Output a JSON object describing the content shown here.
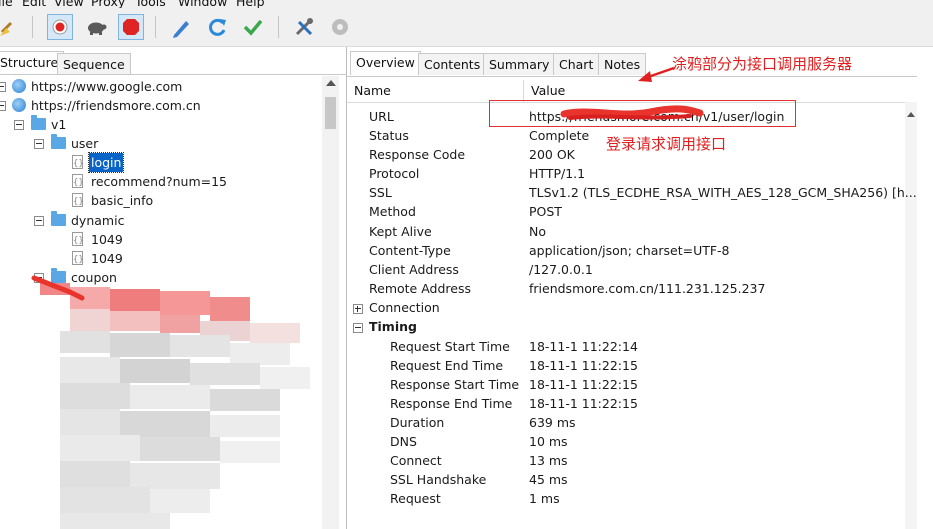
{
  "menu": [
    "ile",
    "Edit",
    "View",
    "Proxy",
    "Tools",
    "Window",
    "Help"
  ],
  "toolbar": {
    "icons": [
      "broom-icon",
      "turtle-icon",
      "record-icon",
      "stop-icon",
      "pen-icon",
      "refresh-icon",
      "check-icon",
      "tools-icon",
      "settings-icon"
    ]
  },
  "left_tabs": [
    "Structure",
    "Sequence"
  ],
  "tree": {
    "hosts": [
      "https://www.google.com",
      "https://friendsmore.com.cn"
    ],
    "v1": "v1",
    "user": "user",
    "user_items": [
      "login",
      "recommend?num=15",
      "basic_info"
    ],
    "dynamic": "dynamic",
    "dynamic_items": [
      "1049",
      "1049"
    ],
    "coupon": "coupon"
  },
  "right_tabs": [
    "Overview",
    "Contents",
    "Summary",
    "Chart",
    "Notes"
  ],
  "grid_headers": {
    "name": "Name",
    "value": "Value"
  },
  "overview": [
    {
      "name": "URL",
      "value": "https://friendsmore.com.cn/v1/user/login"
    },
    {
      "name": "Status",
      "value": "Complete"
    },
    {
      "name": "Response Code",
      "value": "200 OK"
    },
    {
      "name": "Protocol",
      "value": "HTTP/1.1"
    },
    {
      "name": "SSL",
      "value": "TLSv1.2 (TLS_ECDHE_RSA_WITH_AES_128_GCM_SHA256) [h..."
    },
    {
      "name": "Method",
      "value": "POST"
    },
    {
      "name": "Kept Alive",
      "value": "No"
    },
    {
      "name": "Content-Type",
      "value": "application/json; charset=UTF-8"
    },
    {
      "name": "Client Address",
      "value": "/127.0.0.1"
    },
    {
      "name": "Remote Address",
      "value": "friendsmore.com.cn/111.231.125.237"
    }
  ],
  "connection": "Connection",
  "timing": {
    "label": "Timing",
    "rows": [
      {
        "name": "Request Start Time",
        "value": "18-11-1 11:22:14"
      },
      {
        "name": "Request End Time",
        "value": "18-11-1 11:22:15"
      },
      {
        "name": "Response Start Time",
        "value": "18-11-1 11:22:15"
      },
      {
        "name": "Response End Time",
        "value": "18-11-1 11:22:15"
      },
      {
        "name": "Duration",
        "value": "639 ms"
      },
      {
        "name": "DNS",
        "value": "10 ms"
      },
      {
        "name": "Connect",
        "value": "13 ms"
      },
      {
        "name": "SSL Handshake",
        "value": "45 ms"
      },
      {
        "name": "Request",
        "value": "1 ms"
      }
    ]
  },
  "annotations": {
    "top": "涂鸦部分为接口调用服务器",
    "login": "登录请求调用接口"
  },
  "colors": {
    "annotation": "#e02020",
    "selection": "#0a64c8",
    "folder": "#5aa7e6"
  }
}
